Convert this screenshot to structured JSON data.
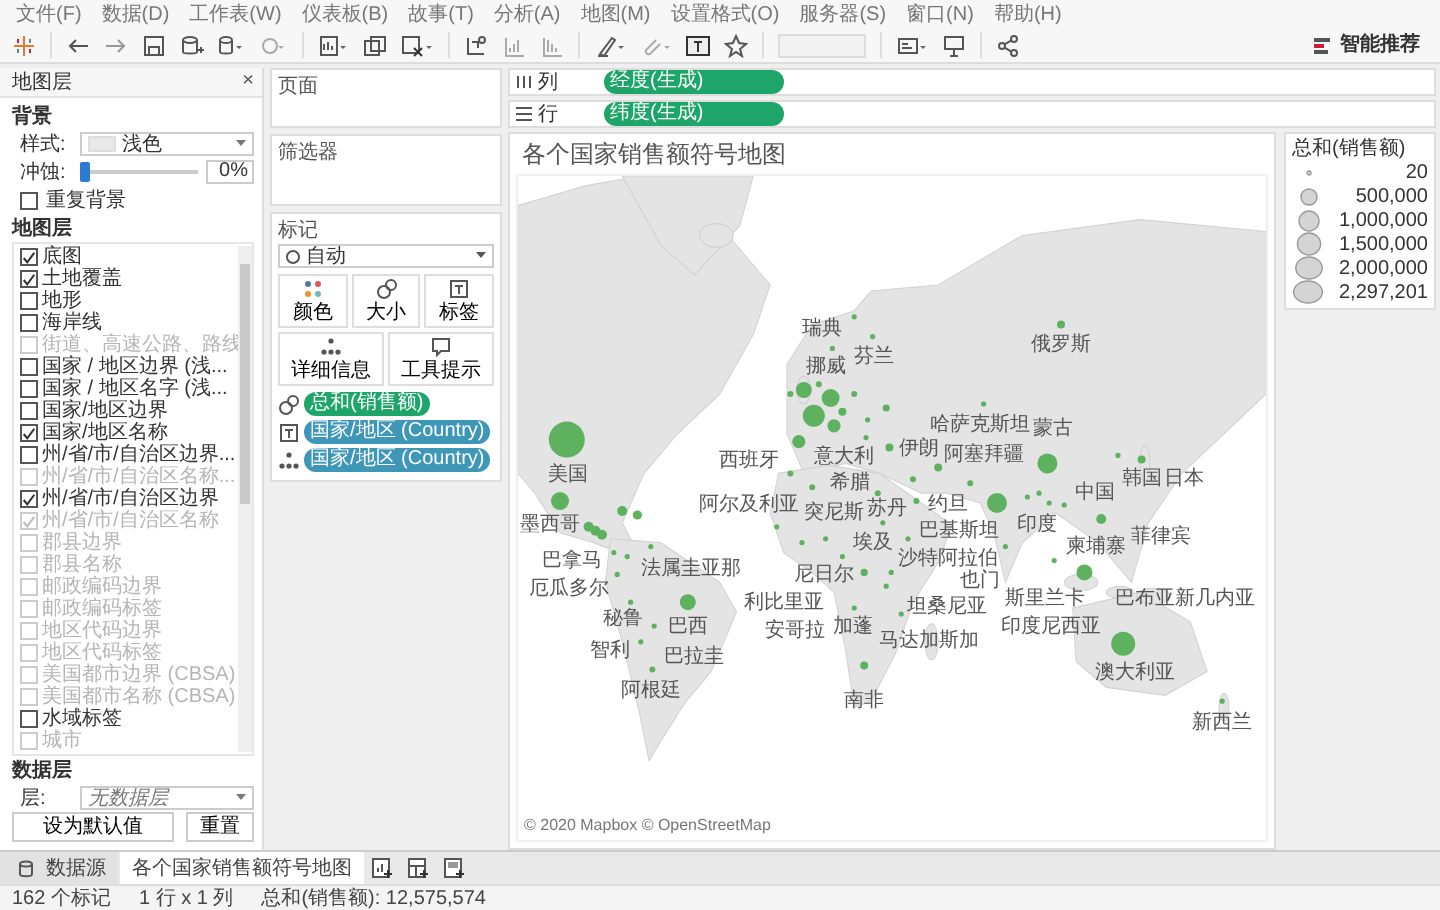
{
  "menu": [
    "文件(F)",
    "数据(D)",
    "工作表(W)",
    "仪表板(B)",
    "故事(T)",
    "分析(A)",
    "地图(M)",
    "设置格式(O)",
    "服务器(S)",
    "窗口(N)",
    "帮助(H)"
  ],
  "toolbar": {
    "show_me": "智能推荐"
  },
  "map_layers_panel": {
    "title": "地图层",
    "close": "×",
    "background_heading": "背景",
    "style_label": "样式:",
    "style_value": "浅色",
    "washout_label": "冲蚀:",
    "washout": {
      "level": 0
    },
    "washout_value": "0%",
    "repeat_background": {
      "label": "重复背景",
      "checked": false
    },
    "layers_heading": "地图层",
    "layers": [
      {
        "label": "底图",
        "checked": true,
        "disabled": false
      },
      {
        "label": "土地覆盖",
        "checked": true,
        "disabled": false
      },
      {
        "label": "地形",
        "checked": false,
        "disabled": false
      },
      {
        "label": "海岸线",
        "checked": false,
        "disabled": false
      },
      {
        "label": "街道、高速公路、路线",
        "checked": false,
        "disabled": true
      },
      {
        "label": "国家 / 地区边界 (浅...",
        "checked": false,
        "disabled": false
      },
      {
        "label": "国家 / 地区名字 (浅...",
        "checked": false,
        "disabled": false
      },
      {
        "label": "国家/地区边界",
        "checked": false,
        "disabled": false
      },
      {
        "label": "国家/地区名称",
        "checked": true,
        "disabled": false
      },
      {
        "label": "州/省/市/自治区边界...",
        "checked": false,
        "disabled": false
      },
      {
        "label": "州/省/市/自治区名称...",
        "checked": false,
        "disabled": true
      },
      {
        "label": "州/省/市/自治区边界",
        "checked": true,
        "disabled": false
      },
      {
        "label": "州/省/市/自治区名称",
        "checked": true,
        "disabled": true
      },
      {
        "label": "郡县边界",
        "checked": false,
        "disabled": true
      },
      {
        "label": "郡县名称",
        "checked": false,
        "disabled": true
      },
      {
        "label": "邮政编码边界",
        "checked": false,
        "disabled": true
      },
      {
        "label": "邮政编码标签",
        "checked": false,
        "disabled": true
      },
      {
        "label": "地区代码边界",
        "checked": false,
        "disabled": true
      },
      {
        "label": "地区代码标签",
        "checked": false,
        "disabled": true
      },
      {
        "label": "美国都市边界 (CBSA)",
        "checked": false,
        "disabled": true
      },
      {
        "label": "美国都市名称 (CBSA)",
        "checked": false,
        "disabled": true
      },
      {
        "label": "水域标签",
        "checked": false,
        "disabled": false
      },
      {
        "label": "城市",
        "checked": false,
        "disabled": true
      }
    ],
    "data_layer_heading": "数据层",
    "data_layer_label": "层:",
    "data_layer_value": "无数据层",
    "buttons": [
      "设为默认值",
      "重置"
    ]
  },
  "pages_card": {
    "title": "页面"
  },
  "filters_card": {
    "title": "筛选器"
  },
  "marks_card": {
    "title": "标记",
    "mark_type": "自动",
    "buttons": [
      {
        "kind": "color",
        "label": "颜色"
      },
      {
        "kind": "size",
        "label": "大小"
      },
      {
        "kind": "label",
        "label": "标签"
      },
      {
        "kind": "detail",
        "label": "详细信息"
      },
      {
        "kind": "tooltip",
        "label": "工具提示"
      }
    ],
    "pills": [
      {
        "kind": "size",
        "color": "#1ea66a",
        "label": "总和(销售额)"
      },
      {
        "kind": "label",
        "color": "#3f97b8",
        "label": "国家/地区 (Country)"
      },
      {
        "kind": "detail",
        "color": "#3f97b8",
        "label": "国家/地区 (Country)"
      }
    ]
  },
  "shelves": [
    {
      "kind": "columns",
      "label": "列",
      "pill": "经度(生成)"
    },
    {
      "kind": "rows",
      "label": "行",
      "pill": "纬度(生成)"
    }
  ],
  "view": {
    "title": "各个国家销售额符号地图",
    "country_labels": [
      "瑞典",
      "俄罗斯",
      "芬兰",
      "挪威",
      "哈萨克斯坦",
      "蒙古",
      "西班牙",
      "意大利",
      "希腊",
      "阿塞拜疆",
      "美国",
      "突尼斯",
      "约旦",
      "伊朗",
      "中国",
      "韩国",
      "日本",
      "阿尔及利亚",
      "埃及",
      "巴基斯坦",
      "沙特阿拉伯",
      "墨西哥",
      "尼日尔",
      "苏丹",
      "也门",
      "印度",
      "柬埔寨",
      "菲律宾",
      "巴拿马",
      "法属圭亚那",
      "利比里亚",
      "斯里兰卡",
      "厄瓜多尔",
      "加蓬",
      "坦桑尼亚",
      "巴布亚新几内亚",
      "秘鲁",
      "巴西",
      "安哥拉",
      "印度尼西亚",
      "智利",
      "巴拉圭",
      "马达加斯加",
      "澳大利亚",
      "阿根廷",
      "南非",
      "新西兰"
    ],
    "attribution": "© 2020 Mapbox © OpenStreetMap"
  },
  "legend": {
    "title": "总和(销售额)",
    "entries": [
      "20",
      "500,000",
      "1,000,000",
      "1,500,000",
      "2,000,000",
      "2,297,201"
    ]
  },
  "sheet_tabs": [
    {
      "kind": "data_source",
      "label": "数据源",
      "selected": false
    },
    {
      "kind": "sheet",
      "label": "各个国家销售额符号地图",
      "selected": true
    }
  ],
  "status_bar": [
    "162 个标记",
    "1 行 x 1 列",
    "总和(销售额): 12,575,574"
  ]
}
